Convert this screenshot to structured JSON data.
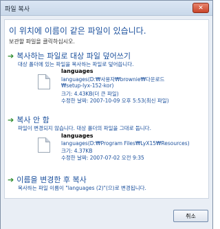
{
  "window": {
    "title": "파일 복사",
    "close_symbol": "✕"
  },
  "header": {
    "heading": "이 위치에 이름이 같은 파일이 있습니다.",
    "subheading": "보관할 파일을 클릭하십시오."
  },
  "options": [
    {
      "title": "복사하는 파일로 대상 파일 덮어쓰기",
      "description": "대상 폴더에 있는 파일을 복사하는 파일로 덮어씁니다.",
      "file": {
        "name": "languages",
        "path_line1": "languages(D:₩사용자₩brownie₩다운로드",
        "path_line2": "₩setup-lyx-152-kor)",
        "size": "크기: 4.43KB(더 큰 파일)",
        "modified": "수정한 날짜: 2007-10-09 오후 5:53(최신 파일)"
      }
    },
    {
      "title": "복사 안 함",
      "description": "파일이 변경되지 않습니다. 대상 폴더의 파일을 그대로 둡니다.",
      "file": {
        "name": "languages",
        "path_line1": "languages(D:₩Program Files₩LyX15₩Resources)",
        "size": "크기: 4.37KB",
        "modified": "수정한 날짜: 2007-07-02 오전 9:35"
      }
    },
    {
      "title": "이름을 변경한 후 복사",
      "description": "복사하는 파일 이름이 \"languages (2)\"(으)로 변경됩니다."
    }
  ],
  "footer": {
    "cancel_label": "취소"
  },
  "icons": {
    "arrow": "➔"
  },
  "colors": {
    "accent_blue": "#1a4f9c",
    "arrow_green": "#2a8a2a"
  }
}
